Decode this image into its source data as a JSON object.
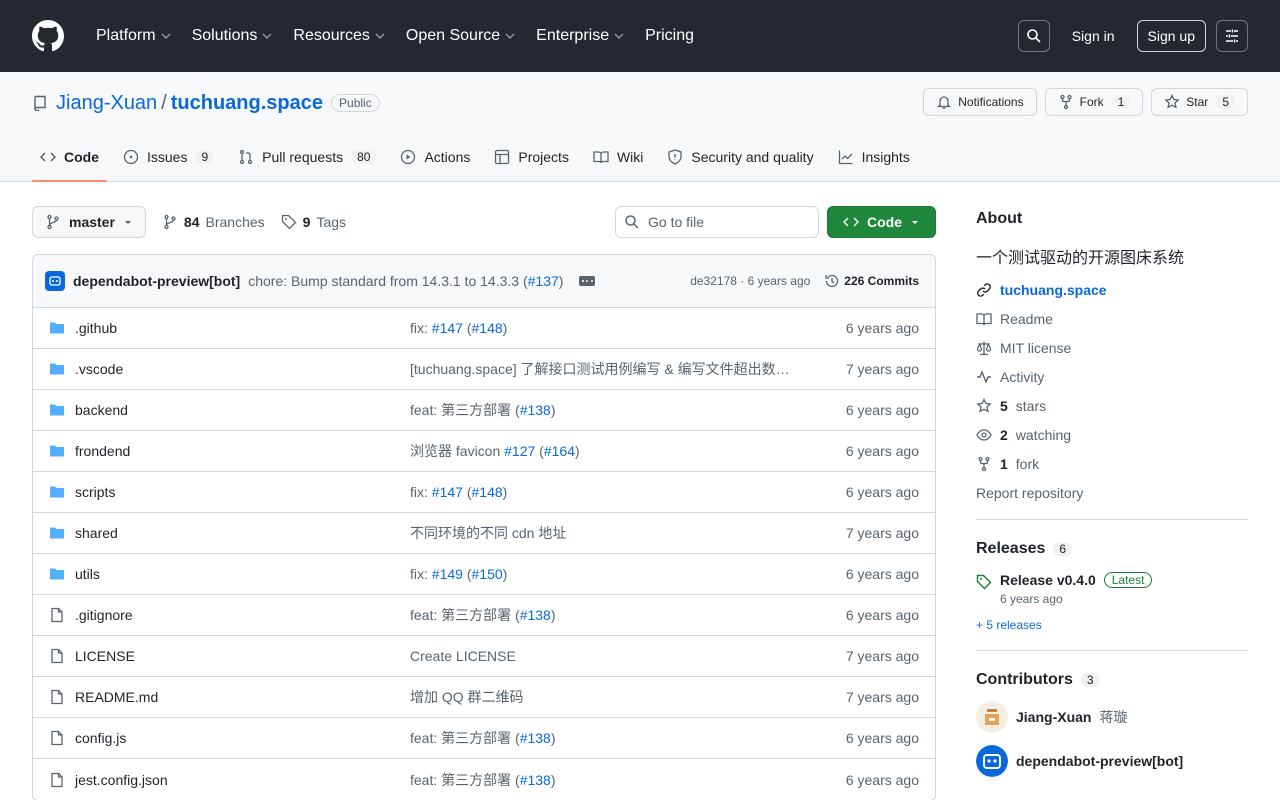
{
  "header": {
    "nav": [
      "Platform",
      "Solutions",
      "Resources",
      "Open Source",
      "Enterprise",
      "Pricing"
    ],
    "sign_in": "Sign in",
    "sign_up": "Sign up"
  },
  "repo": {
    "owner": "Jiang-Xuan",
    "name": "tuchuang.space",
    "visibility": "Public",
    "notifications_label": "Notifications",
    "fork_label": "Fork",
    "fork_count": "1",
    "star_label": "Star",
    "star_count": "5"
  },
  "tabs": [
    {
      "label": "Code",
      "count": ""
    },
    {
      "label": "Issues",
      "count": "9"
    },
    {
      "label": "Pull requests",
      "count": "80"
    },
    {
      "label": "Actions",
      "count": ""
    },
    {
      "label": "Projects",
      "count": ""
    },
    {
      "label": "Wiki",
      "count": ""
    },
    {
      "label": "Security and quality",
      "count": ""
    },
    {
      "label": "Insights",
      "count": ""
    }
  ],
  "filebar": {
    "branch": "master",
    "branches_count": "84",
    "branches_label": "Branches",
    "tags_count": "9",
    "tags_label": "Tags",
    "goto_placeholder": "Go to file",
    "code_label": "Code"
  },
  "latest_commit": {
    "author": "dependabot-preview[bot]",
    "message": "chore: Bump standard from 14.3.1 to 14.3.3 (",
    "pr": "#137",
    "message_end": ")",
    "sha_time": "de32178 · 6 years ago",
    "commits": "226 Commits"
  },
  "files": [
    {
      "type": "dir",
      "name": ".github",
      "msg": "fix: ",
      "l1": "#147",
      "mid": " (",
      "l2": "#148",
      "end": ")",
      "age": "6 years ago"
    },
    {
      "type": "dir",
      "name": ".vscode",
      "msg": "[tuchuang.space] 了解接口测试用例编写 & 编写文件超出数…",
      "l1": "",
      "mid": "",
      "l2": "",
      "end": "",
      "age": "7 years ago"
    },
    {
      "type": "dir",
      "name": "backend",
      "msg": "feat: 第三方部署 (",
      "l1": "#138",
      "mid": "",
      "l2": "",
      "end": ")",
      "age": "6 years ago"
    },
    {
      "type": "dir",
      "name": "frondend",
      "msg": "浏览器 favicon ",
      "l1": "#127",
      "mid": " (",
      "l2": "#164",
      "end": ")",
      "age": "6 years ago"
    },
    {
      "type": "dir",
      "name": "scripts",
      "msg": "fix: ",
      "l1": "#147",
      "mid": " (",
      "l2": "#148",
      "end": ")",
      "age": "6 years ago"
    },
    {
      "type": "dir",
      "name": "shared",
      "msg": "不同环境的不同 cdn 地址",
      "l1": "",
      "mid": "",
      "l2": "",
      "end": "",
      "age": "7 years ago"
    },
    {
      "type": "dir",
      "name": "utils",
      "msg": "fix: ",
      "l1": "#149",
      "mid": " (",
      "l2": "#150",
      "end": ")",
      "age": "6 years ago"
    },
    {
      "type": "file",
      "name": ".gitignore",
      "msg": "feat: 第三方部署 (",
      "l1": "#138",
      "mid": "",
      "l2": "",
      "end": ")",
      "age": "6 years ago"
    },
    {
      "type": "file",
      "name": "LICENSE",
      "msg": "Create LICENSE",
      "l1": "",
      "mid": "",
      "l2": "",
      "end": "",
      "age": "7 years ago"
    },
    {
      "type": "file",
      "name": "README.md",
      "msg": "增加 QQ 群二维码",
      "l1": "",
      "mid": "",
      "l2": "",
      "end": "",
      "age": "7 years ago"
    },
    {
      "type": "file",
      "name": "config.js",
      "msg": "feat: 第三方部署 (",
      "l1": "#138",
      "mid": "",
      "l2": "",
      "end": ")",
      "age": "6 years ago"
    },
    {
      "type": "file",
      "name": "jest.config.json",
      "msg": "feat: 第三方部署 (",
      "l1": "#138",
      "mid": "",
      "l2": "",
      "end": ")",
      "age": "6 years ago"
    }
  ],
  "about": {
    "heading": "About",
    "description": "一个测试驱动的开源图床系统",
    "website": "tuchuang.space",
    "readme": "Readme",
    "license": "MIT license",
    "activity": "Activity",
    "stars_count": "5",
    "stars_label": "stars",
    "watching_count": "2",
    "watching_label": "watching",
    "fork_count": "1",
    "fork_label": "fork",
    "report": "Report repository"
  },
  "releases": {
    "heading": "Releases",
    "count": "6",
    "latest_name": "Release v0.4.0",
    "latest_badge": "Latest",
    "latest_date": "6 years ago",
    "more": "+ 5 releases"
  },
  "contributors": {
    "heading": "Contributors",
    "count": "3",
    "list": [
      {
        "login": "Jiang-Xuan",
        "name": "蒋璇"
      },
      {
        "login": "dependabot-preview[bot]",
        "name": ""
      }
    ]
  },
  "colors": {
    "header_bg": "#24292f",
    "link": "#0969da",
    "green": "#1f883d",
    "folder": "#54aeff",
    "tab_underline": "#fd8c73"
  }
}
